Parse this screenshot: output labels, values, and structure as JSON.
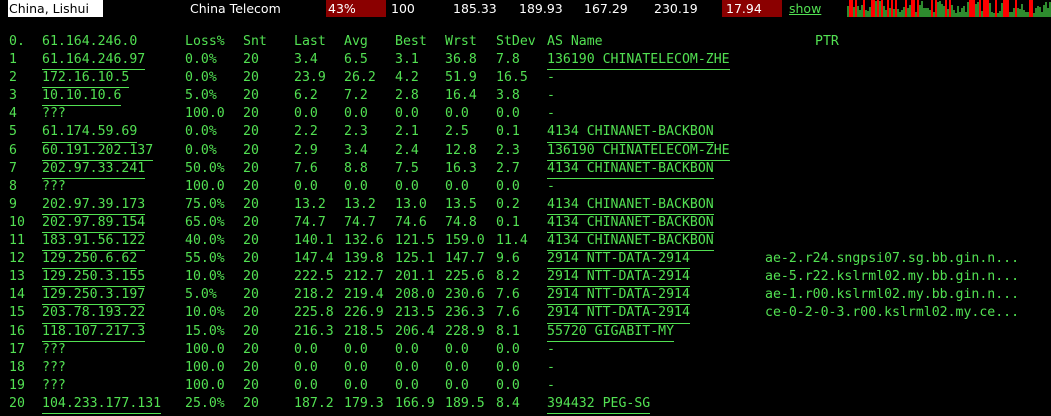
{
  "header": {
    "location": "China, Lishui",
    "isp": "China Telecom",
    "loss": "43%",
    "snt": "100",
    "last": "185.33",
    "avg": "189.93",
    "best": "167.29",
    "wrst": "230.19",
    "stdev": "17.94",
    "show_label": "show",
    "colors": {
      "highlight": "#8b0000",
      "text": "#52e052",
      "spark_ok": "#2e8b2e",
      "spark_loss": "#ff0000"
    }
  },
  "columns": {
    "idx": "0.",
    "host": "61.164.246.0",
    "loss": "Loss%",
    "snt": "Snt",
    "last": "Last",
    "avg": "Avg",
    "best": "Best",
    "wrst": "Wrst",
    "stdev": "StDev",
    "as": "AS Name",
    "ptr": "PTR"
  },
  "hops": [
    {
      "idx": "1",
      "host": "61.164.246.97",
      "loss": "0.0%",
      "snt": "20",
      "last": "3.4",
      "avg": "6.5",
      "best": "3.1",
      "wrst": "36.8",
      "stdev": "7.8",
      "as": "136190 CHINATELECOM-ZHE",
      "ptr": ""
    },
    {
      "idx": "2",
      "host": "172.16.10.5",
      "loss": "0.0%",
      "snt": "20",
      "last": "23.9",
      "avg": "26.2",
      "best": "4.2",
      "wrst": "51.9",
      "stdev": "16.5",
      "as": "-",
      "ptr": ""
    },
    {
      "idx": "3",
      "host": "10.10.10.6",
      "loss": "5.0%",
      "snt": "20",
      "last": "6.2",
      "avg": "7.2",
      "best": "2.8",
      "wrst": "16.4",
      "stdev": "3.8",
      "as": "-",
      "ptr": ""
    },
    {
      "idx": "4",
      "host": "???",
      "loss": "100.0",
      "snt": "20",
      "last": "0.0",
      "avg": "0.0",
      "best": "0.0",
      "wrst": "0.0",
      "stdev": "0.0",
      "as": "-",
      "ptr": ""
    },
    {
      "idx": "5",
      "host": "61.174.59.69",
      "loss": "0.0%",
      "snt": "20",
      "last": "2.2",
      "avg": "2.3",
      "best": "2.1",
      "wrst": "2.5",
      "stdev": "0.1",
      "as": "4134  CHINANET-BACKBON",
      "ptr": ""
    },
    {
      "idx": "6",
      "host": "60.191.202.137",
      "loss": "0.0%",
      "snt": "20",
      "last": "2.9",
      "avg": "3.4",
      "best": "2.4",
      "wrst": "12.8",
      "stdev": "2.3",
      "as": "136190 CHINATELECOM-ZHE",
      "ptr": ""
    },
    {
      "idx": "7",
      "host": "202.97.33.241",
      "loss": "50.0%",
      "snt": "20",
      "last": "7.6",
      "avg": "8.8",
      "best": "7.5",
      "wrst": "16.3",
      "stdev": "2.7",
      "as": "4134  CHINANET-BACKBON",
      "ptr": ""
    },
    {
      "idx": "8",
      "host": "???",
      "loss": "100.0",
      "snt": "20",
      "last": "0.0",
      "avg": "0.0",
      "best": "0.0",
      "wrst": "0.0",
      "stdev": "0.0",
      "as": "-",
      "ptr": ""
    },
    {
      "idx": "9",
      "host": "202.97.39.173",
      "loss": "75.0%",
      "snt": "20",
      "last": "13.2",
      "avg": "13.2",
      "best": "13.0",
      "wrst": "13.5",
      "stdev": "0.2",
      "as": "4134  CHINANET-BACKBON",
      "ptr": ""
    },
    {
      "idx": "10",
      "host": "202.97.89.154",
      "loss": "65.0%",
      "snt": "20",
      "last": "74.7",
      "avg": "74.7",
      "best": "74.6",
      "wrst": "74.8",
      "stdev": "0.1",
      "as": "4134  CHINANET-BACKBON",
      "ptr": ""
    },
    {
      "idx": "11",
      "host": "183.91.56.122",
      "loss": "40.0%",
      "snt": "20",
      "last": "140.1",
      "avg": "132.6",
      "best": "121.5",
      "wrst": "159.0",
      "stdev": "11.4",
      "as": "4134  CHINANET-BACKBON",
      "ptr": ""
    },
    {
      "idx": "12",
      "host": "129.250.6.62",
      "loss": "55.0%",
      "snt": "20",
      "last": "147.4",
      "avg": "139.8",
      "best": "125.1",
      "wrst": "147.7",
      "stdev": "9.6",
      "as": "2914  NTT-DATA-2914",
      "ptr": "ae-2.r24.sngpsi07.sg.bb.gin.n..."
    },
    {
      "idx": "13",
      "host": "129.250.3.155",
      "loss": "10.0%",
      "snt": "20",
      "last": "222.5",
      "avg": "212.7",
      "best": "201.1",
      "wrst": "225.6",
      "stdev": "8.2",
      "as": "2914  NTT-DATA-2914",
      "ptr": "ae-5.r22.kslrml02.my.bb.gin.n..."
    },
    {
      "idx": "14",
      "host": "129.250.3.197",
      "loss": "5.0%",
      "snt": "20",
      "last": "218.2",
      "avg": "219.4",
      "best": "208.0",
      "wrst": "230.6",
      "stdev": "7.6",
      "as": "2914  NTT-DATA-2914",
      "ptr": "ae-1.r00.kslrml02.my.bb.gin.n..."
    },
    {
      "idx": "15",
      "host": "203.78.193.22",
      "loss": "10.0%",
      "snt": "20",
      "last": "225.8",
      "avg": "226.9",
      "best": "213.5",
      "wrst": "236.3",
      "stdev": "7.6",
      "as": "2914  NTT-DATA-2914",
      "ptr": "ce-0-2-0-3.r00.kslrml02.my.ce..."
    },
    {
      "idx": "16",
      "host": "118.107.217.3",
      "loss": "15.0%",
      "snt": "20",
      "last": "216.3",
      "avg": "218.5",
      "best": "206.4",
      "wrst": "228.9",
      "stdev": "8.1",
      "as": "55720 GIGABIT-MY",
      "ptr": ""
    },
    {
      "idx": "17",
      "host": "???",
      "loss": "100.0",
      "snt": "20",
      "last": "0.0",
      "avg": "0.0",
      "best": "0.0",
      "wrst": "0.0",
      "stdev": "0.0",
      "as": "-",
      "ptr": ""
    },
    {
      "idx": "18",
      "host": "???",
      "loss": "100.0",
      "snt": "20",
      "last": "0.0",
      "avg": "0.0",
      "best": "0.0",
      "wrst": "0.0",
      "stdev": "0.0",
      "as": "-",
      "ptr": ""
    },
    {
      "idx": "19",
      "host": "???",
      "loss": "100.0",
      "snt": "20",
      "last": "0.0",
      "avg": "0.0",
      "best": "0.0",
      "wrst": "0.0",
      "stdev": "0.0",
      "as": "-",
      "ptr": ""
    },
    {
      "idx": "20",
      "host": "104.233.177.131",
      "loss": "25.0%",
      "snt": "20",
      "last": "187.2",
      "avg": "179.3",
      "best": "166.9",
      "wrst": "189.5",
      "stdev": "8.4",
      "as": "394432 PEG-SG",
      "ptr": ""
    }
  ]
}
